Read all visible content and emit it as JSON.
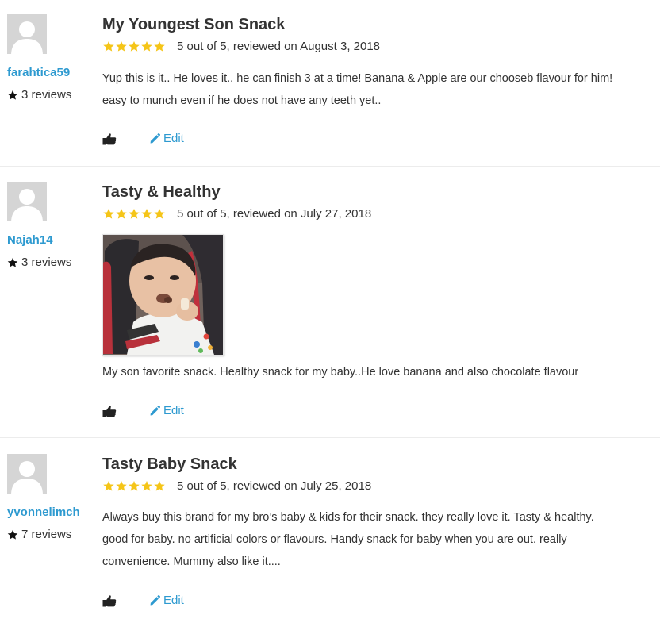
{
  "colors": {
    "accent": "#2e9ad0",
    "star": "#f5c518",
    "text": "#333333",
    "divider": "#ececec",
    "avatar_bg": "#d5d5d5"
  },
  "reviews": [
    {
      "username": "farahtica59",
      "review_count": "3 reviews",
      "title": "My Youngest Son Snack",
      "rating": 5,
      "rating_text": "5 out of 5, reviewed on August 3, 2018",
      "body_lines": [
        "Yup this is it.. He loves it.. he can finish 3 at a time! Banana & Apple are our chooseb flavour for him!",
        "easy to munch even if he does not have any teeth yet.."
      ],
      "edit_label": "Edit",
      "like_icon": "thumbs-up-icon"
    },
    {
      "username": "Najah14",
      "review_count": "3 reviews",
      "title": "Tasty & Healthy",
      "rating": 5,
      "rating_text": "5 out of 5, reviewed on July 27, 2018",
      "has_photo": true,
      "body_lines": [
        "My son favorite snack. Healthy snack for my baby..He love banana and also chocolate flavour"
      ],
      "edit_label": "Edit",
      "like_icon": "thumbs-up-icon"
    },
    {
      "username": "yvonnelimch",
      "review_count": "7 reviews",
      "title": "Tasty Baby Snack",
      "rating": 5,
      "rating_text": "5 out of 5, reviewed on July 25, 2018",
      "body_lines": [
        "Always buy this brand for my bro’s baby & kids for their snack. they really love it. Tasty & healthy.",
        "good for baby. no artificial colors or flavours. Handy snack for baby when you are out. really",
        "convenience. Mummy also like it...."
      ],
      "edit_label": "Edit",
      "like_icon": "thumbs-up-icon"
    }
  ]
}
